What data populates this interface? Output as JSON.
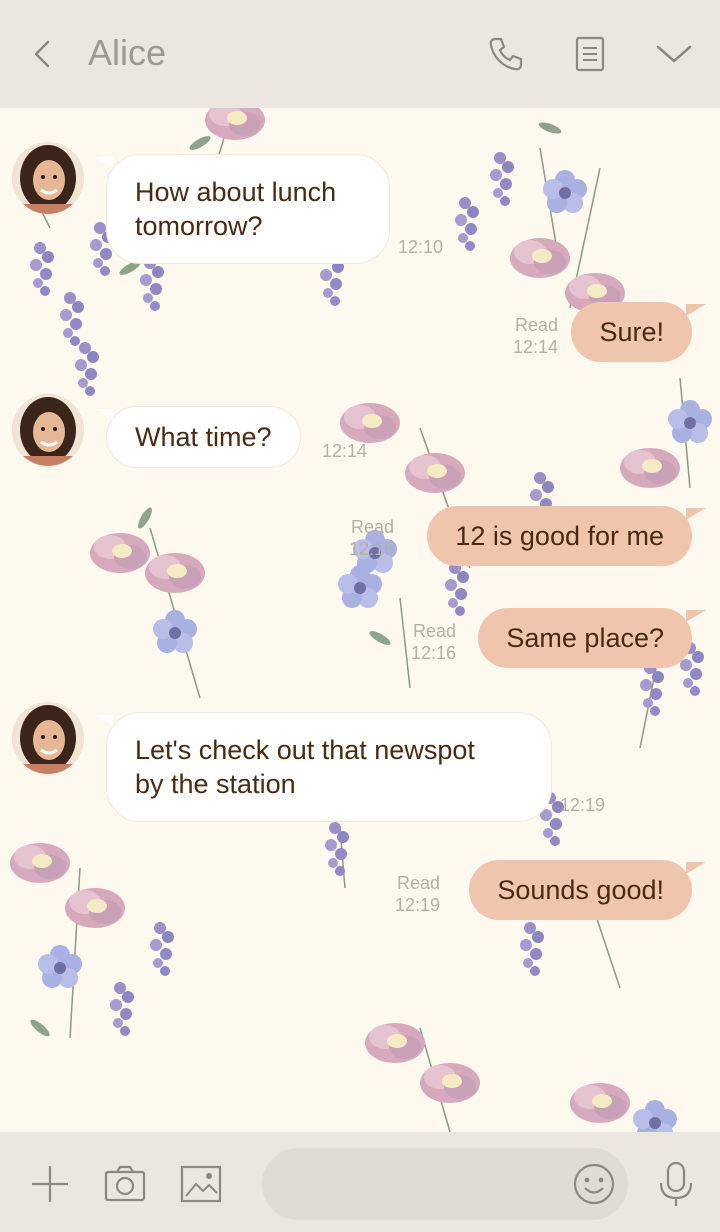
{
  "header": {
    "title": "Alice",
    "icons": [
      "back-arrow-icon",
      "phone-icon",
      "note-icon",
      "chevron-down-icon"
    ]
  },
  "messages": [
    {
      "id": 1,
      "from": "Alice",
      "lines": [
        "How about lunch",
        "tomorrow?"
      ],
      "time": "12:10"
    },
    {
      "id": 2,
      "from": "me",
      "text": "Sure!",
      "read": "Read",
      "time": "12:14"
    },
    {
      "id": 3,
      "from": "Alice",
      "text": "What time?",
      "time": "12:14"
    },
    {
      "id": 4,
      "from": "me",
      "text": "12 is good for me",
      "read": "Read",
      "time": "12:16"
    },
    {
      "id": 5,
      "from": "me",
      "text": "Same place?",
      "read": "Read",
      "time": "12:16"
    },
    {
      "id": 6,
      "from": "Alice",
      "lines": [
        "Let's check out that newspot",
        "by the station"
      ],
      "time": "12:19"
    },
    {
      "id": 7,
      "from": "me",
      "text": "Sounds good!",
      "read": "Read",
      "time": "12:19"
    }
  ],
  "input": {
    "value": "",
    "icons": [
      "plus-icon",
      "camera-icon",
      "image-icon",
      "smiley-icon",
      "microphone-icon"
    ]
  },
  "colors": {
    "header_bg": "#ebe6df",
    "chat_bg": "#fdf9ee",
    "incoming_bubble": "#ffffff",
    "outgoing_bubble": "#efc5ae",
    "message_text": "#4a2a12",
    "meta_text": "#b4afa7"
  }
}
